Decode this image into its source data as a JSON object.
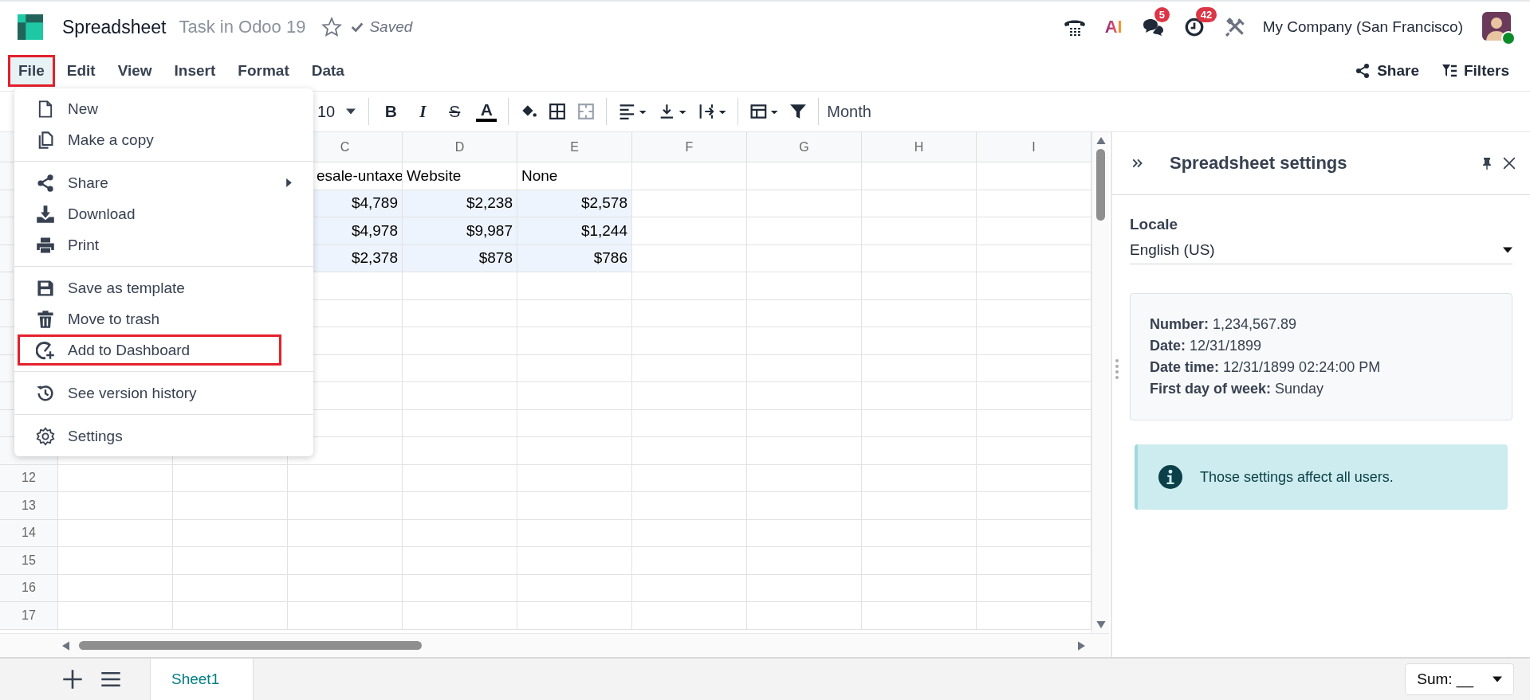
{
  "app": {
    "title": "Spreadsheet",
    "breadcrumb": "Task in Odoo 19",
    "favorite": false,
    "status": "Saved"
  },
  "systray": {
    "ai_label": "AI",
    "chat_count": "5",
    "activity_count": "42",
    "company": "My Company (San Francisco)",
    "online": true
  },
  "menubar": [
    {
      "label": "File",
      "selected": true,
      "highlighted": true
    },
    {
      "label": "Edit",
      "selected": false,
      "highlighted": false
    },
    {
      "label": "View",
      "selected": false,
      "highlighted": false
    },
    {
      "label": "Insert",
      "selected": false,
      "highlighted": false
    },
    {
      "label": "Format",
      "selected": false,
      "highlighted": false
    },
    {
      "label": "Data",
      "selected": false,
      "highlighted": false
    }
  ],
  "actions": [
    {
      "kind": "share",
      "label": "Share"
    },
    {
      "kind": "filters",
      "label": "Filters"
    }
  ],
  "toolbar": {
    "font_size": "10",
    "format_buttons": [
      {
        "kind": "bold",
        "glyph": "B"
      },
      {
        "kind": "italic",
        "glyph": "I"
      },
      {
        "kind": "strike",
        "glyph": "S"
      },
      {
        "kind": "color",
        "glyph": "A"
      }
    ],
    "formula": "Month"
  },
  "file_menu": [
    [
      {
        "kind": "new",
        "label": "New",
        "submenu": false,
        "highlighted": false
      },
      {
        "kind": "copy",
        "label": "Make a copy",
        "submenu": false,
        "highlighted": false
      }
    ],
    [
      {
        "kind": "share",
        "label": "Share",
        "submenu": true,
        "highlighted": false
      },
      {
        "kind": "download",
        "label": "Download",
        "submenu": false,
        "highlighted": false
      },
      {
        "kind": "print",
        "label": "Print",
        "submenu": false,
        "highlighted": false
      }
    ],
    [
      {
        "kind": "template",
        "label": "Save as template",
        "submenu": false,
        "highlighted": false
      },
      {
        "kind": "trash",
        "label": "Move to trash",
        "submenu": false,
        "highlighted": false
      },
      {
        "kind": "dashboard",
        "label": "Add to Dashboard",
        "submenu": false,
        "highlighted": true
      }
    ],
    [
      {
        "kind": "history",
        "label": "See version history",
        "submenu": false,
        "highlighted": false
      }
    ],
    [
      {
        "kind": "settings",
        "label": "Settings",
        "submenu": false,
        "highlighted": false
      }
    ]
  ],
  "grid": {
    "columns": [
      "C",
      "D",
      "E",
      "F",
      "G",
      "H",
      "I"
    ],
    "row_numbers": [
      "12",
      "13",
      "14",
      "15",
      "16",
      "17"
    ],
    "rows": [
      {
        "cells": [
          {
            "text": "esale-untaxe",
            "filled": false
          },
          {
            "text": "Website",
            "filled": false
          },
          {
            "text": "None",
            "filled": false
          }
        ]
      },
      {
        "cells": [
          {
            "text": "$4,789",
            "filled": true
          },
          {
            "text": "$2,238",
            "filled": true
          },
          {
            "text": "$2,578",
            "filled": true
          }
        ]
      },
      {
        "cells": [
          {
            "text": "$4,978",
            "filled": true
          },
          {
            "text": "$9,987",
            "filled": true
          },
          {
            "text": "$1,244",
            "filled": true
          }
        ]
      },
      {
        "cells": [
          {
            "text": "$2,378",
            "filled": true
          },
          {
            "text": "$878",
            "filled": true
          },
          {
            "text": "$786",
            "filled": true
          }
        ]
      }
    ]
  },
  "panel": {
    "title": "Spreadsheet settings",
    "locale_label": "Locale",
    "locale": "English (US)",
    "preview": [
      {
        "label": "Number:",
        "value": "1,234,567.89"
      },
      {
        "label": "Date:",
        "value": "12/31/1899"
      },
      {
        "label": "Date time:",
        "value": "12/31/1899 02:24:00 PM"
      },
      {
        "label": "First day of week:",
        "value": "Sunday"
      }
    ],
    "notice": "Those settings affect all users."
  },
  "bottom": {
    "sheets": [
      {
        "name": "Sheet1",
        "selected": true
      }
    ],
    "aggregate": "Sum: __"
  }
}
